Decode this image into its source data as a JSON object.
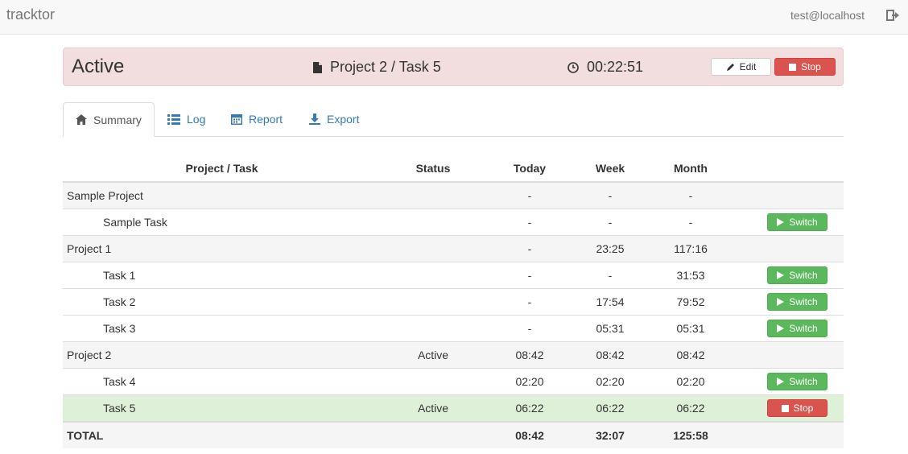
{
  "navbar": {
    "brand": "tracktor",
    "user": "test@localhost"
  },
  "active": {
    "title": "Active",
    "task": "Project 2 / Task 5",
    "elapsed": "00:22:51",
    "edit_label": "Edit",
    "stop_label": "Stop"
  },
  "tabs": [
    {
      "label": "Summary",
      "icon": "home-icon"
    },
    {
      "label": "Log",
      "icon": "list-icon"
    },
    {
      "label": "Report",
      "icon": "calendar-icon"
    },
    {
      "label": "Export",
      "icon": "download-icon"
    }
  ],
  "table": {
    "headers": {
      "name": "Project / Task",
      "status": "Status",
      "today": "Today",
      "week": "Week",
      "month": "Month"
    },
    "rows": [
      {
        "name": "Sample Project",
        "status": "",
        "today": "-",
        "week": "-",
        "month": "-",
        "action": ""
      },
      {
        "name": "Sample Task",
        "status": "",
        "today": "-",
        "week": "-",
        "month": "-",
        "action": "Switch"
      },
      {
        "name": "Project 1",
        "status": "",
        "today": "-",
        "week": "23:25",
        "month": "117:16",
        "action": ""
      },
      {
        "name": "Task 1",
        "status": "",
        "today": "-",
        "week": "-",
        "month": "31:53",
        "action": "Switch"
      },
      {
        "name": "Task 2",
        "status": "",
        "today": "-",
        "week": "17:54",
        "month": "79:52",
        "action": "Switch"
      },
      {
        "name": "Task 3",
        "status": "",
        "today": "-",
        "week": "05:31",
        "month": "05:31",
        "action": "Switch"
      },
      {
        "name": "Project 2",
        "status": "Active",
        "today": "08:42",
        "week": "08:42",
        "month": "08:42",
        "action": ""
      },
      {
        "name": "Task 4",
        "status": "",
        "today": "02:20",
        "week": "02:20",
        "month": "02:20",
        "action": "Switch"
      },
      {
        "name": "Task 5",
        "status": "Active",
        "today": "06:22",
        "week": "06:22",
        "month": "06:22",
        "action": "Stop"
      }
    ],
    "total": {
      "label": "TOTAL",
      "today": "08:42",
      "week": "32:07",
      "month": "125:58"
    }
  },
  "colors": {
    "active_bg": "#f2dede",
    "switch_green": "#5cb85c",
    "stop_red": "#d9534f",
    "current_row": "#dff0d8",
    "link": "#337ab7"
  }
}
